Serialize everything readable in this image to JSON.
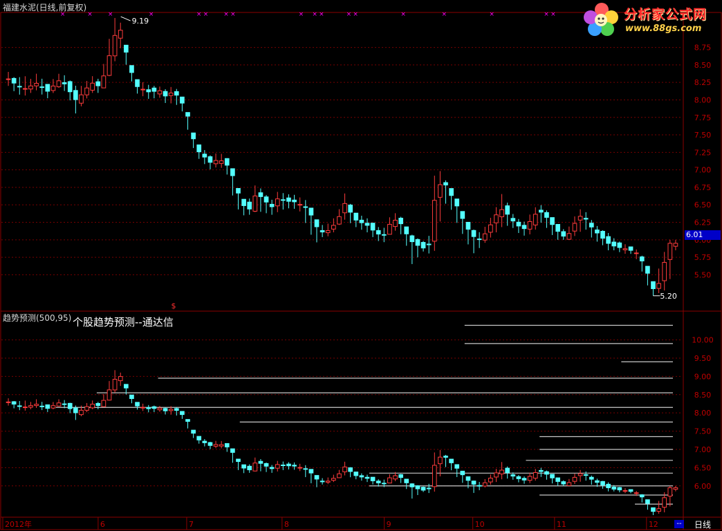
{
  "header": {
    "stock_title": "福建水泥(日线,前复权)",
    "indicator_title": "趋势预测(500,95)",
    "indicator_subtitle": "个股趋势预测--通达信",
    "period_label": "日线",
    "period_button": "--"
  },
  "logo": {
    "main_text": "分析家公式网",
    "url_text": "www.88gs.com"
  },
  "colors": {
    "background": "#000000",
    "frame": "#8b0000",
    "up_candle": "#ff3c3c",
    "down_candle": "#54ffff",
    "axis_text": "#c00000",
    "marker": "#ff00ff",
    "forecast_line": "#c8c8c8"
  },
  "chart_data": [
    {
      "type": "candlestick",
      "title": "福建水泥(日线,前复权)",
      "y_ticks": [
        5.5,
        5.75,
        6.0,
        6.25,
        6.5,
        6.75,
        7.0,
        7.25,
        7.5,
        7.75,
        8.0,
        8.25,
        8.5,
        8.75
      ],
      "ylim": [
        5.0,
        9.25
      ],
      "last_price_label": "6.01",
      "high_annotation": "9.19",
      "low_annotation": "5.20",
      "signal_label": "$",
      "x_labels": [
        "2012年",
        "6",
        "7",
        "8",
        "9",
        "10",
        "11",
        "12"
      ],
      "close_path": [
        8.3,
        8.22,
        8.15,
        8.2,
        8.25,
        8.1,
        8.2,
        8.3,
        8.15,
        8.0,
        8.1,
        8.25,
        8.2,
        8.4,
        8.9,
        9.0,
        8.55,
        8.2,
        8.15,
        8.1,
        8.15,
        8.05,
        8.12,
        8.0,
        7.75,
        7.3,
        7.2,
        7.1,
        7.15,
        7.1,
        6.9,
        6.55,
        6.4,
        6.65,
        6.6,
        6.45,
        6.6,
        6.55,
        6.55,
        6.5,
        6.45,
        6.2,
        6.1,
        6.15,
        6.3,
        6.55,
        6.3,
        6.25,
        6.2,
        6.1,
        6.05,
        6.25,
        6.3,
        6.1,
        5.95,
        5.9,
        5.85,
        6.7,
        6.85,
        6.65,
        6.45,
        6.2,
        6.05,
        6.0,
        6.15,
        6.35,
        6.45,
        6.3,
        6.2,
        6.15,
        6.35,
        6.4,
        6.3,
        6.15,
        6.05,
        6.1,
        6.35,
        6.3,
        6.15,
        6.05,
        5.95,
        5.9,
        5.88,
        5.85,
        5.8,
        5.6,
        5.3,
        5.4,
        5.95,
        5.95
      ],
      "high_path": [
        8.4,
        8.3,
        8.35,
        8.3,
        8.4,
        8.2,
        8.3,
        8.4,
        8.3,
        8.2,
        8.2,
        8.35,
        8.3,
        8.6,
        9.19,
        9.1,
        8.65,
        8.3,
        8.25,
        8.2,
        8.2,
        8.15,
        8.2,
        8.1,
        7.8,
        7.4,
        7.3,
        7.2,
        7.25,
        7.2,
        7.0,
        6.6,
        6.55,
        6.8,
        6.7,
        6.55,
        6.7,
        6.65,
        6.65,
        6.6,
        6.55,
        6.3,
        6.2,
        6.25,
        6.4,
        6.7,
        6.4,
        6.35,
        6.3,
        6.2,
        6.15,
        6.35,
        6.4,
        6.2,
        6.05,
        6.0,
        5.95,
        7.1,
        6.9,
        6.75,
        6.55,
        6.3,
        6.15,
        6.1,
        6.25,
        6.45,
        6.7,
        6.4,
        6.3,
        6.25,
        6.45,
        6.5,
        6.4,
        6.25,
        6.15,
        6.2,
        6.45,
        6.4,
        6.25,
        6.15,
        6.1,
        6.0,
        5.95,
        5.9,
        5.85,
        5.7,
        5.4,
        5.65,
        6.0,
        6.0
      ],
      "low_path": [
        8.2,
        8.1,
        8.05,
        8.1,
        8.15,
        8.0,
        8.1,
        8.2,
        8.05,
        7.8,
        7.95,
        8.1,
        8.1,
        8.2,
        8.5,
        8.75,
        8.4,
        8.1,
        8.05,
        8.0,
        8.05,
        7.95,
        7.95,
        7.9,
        7.55,
        7.2,
        7.1,
        7.0,
        7.05,
        7.0,
        6.6,
        6.35,
        6.35,
        6.4,
        6.4,
        6.35,
        6.4,
        6.45,
        6.45,
        6.4,
        6.15,
        5.95,
        6.05,
        6.05,
        6.2,
        6.3,
        6.2,
        6.15,
        6.1,
        6.0,
        5.95,
        6.1,
        6.15,
        5.95,
        5.6,
        5.85,
        5.8,
        5.85,
        6.55,
        6.45,
        6.2,
        6.0,
        5.8,
        5.9,
        6.0,
        6.1,
        6.2,
        6.2,
        6.1,
        6.05,
        6.1,
        6.25,
        6.15,
        6.0,
        6.0,
        6.0,
        6.1,
        6.15,
        6.0,
        5.95,
        5.85,
        5.85,
        5.8,
        5.8,
        5.7,
        5.4,
        5.2,
        5.25,
        5.3,
        5.85
      ]
    },
    {
      "type": "candlestick",
      "title": "趋势预测(500,95)",
      "y_ticks": [
        6.0,
        6.5,
        7.0,
        7.5,
        8.0,
        8.5,
        9.0,
        9.5,
        10.0
      ],
      "ylim": [
        5.2,
        10.75
      ],
      "x_labels": [
        "2012年",
        "6",
        "7",
        "8",
        "9",
        "10",
        "11",
        "12"
      ],
      "forecast_levels": [
        {
          "value": 10.4,
          "start_bar_fraction": 0.68
        },
        {
          "value": 9.9,
          "start_bar_fraction": 0.68
        },
        {
          "value": 9.4,
          "start_bar_fraction": 0.91
        },
        {
          "value": 8.95,
          "start_bar_fraction": 0.23
        },
        {
          "value": 8.55,
          "start_bar_fraction": 0.14
        },
        {
          "value": 8.15,
          "start_bar_fraction": 0.08
        },
        {
          "value": 7.75,
          "start_bar_fraction": 0.35
        },
        {
          "value": 7.35,
          "start_bar_fraction": 0.79
        },
        {
          "value": 7.0,
          "start_bar_fraction": 0.79
        },
        {
          "value": 6.7,
          "start_bar_fraction": 0.77
        },
        {
          "value": 6.35,
          "start_bar_fraction": 0.54
        },
        {
          "value": 6.0,
          "start_bar_fraction": 0.54
        },
        {
          "value": 5.75,
          "start_bar_fraction": 0.79
        },
        {
          "value": 5.5,
          "start_bar_fraction": 0.93
        }
      ]
    }
  ]
}
